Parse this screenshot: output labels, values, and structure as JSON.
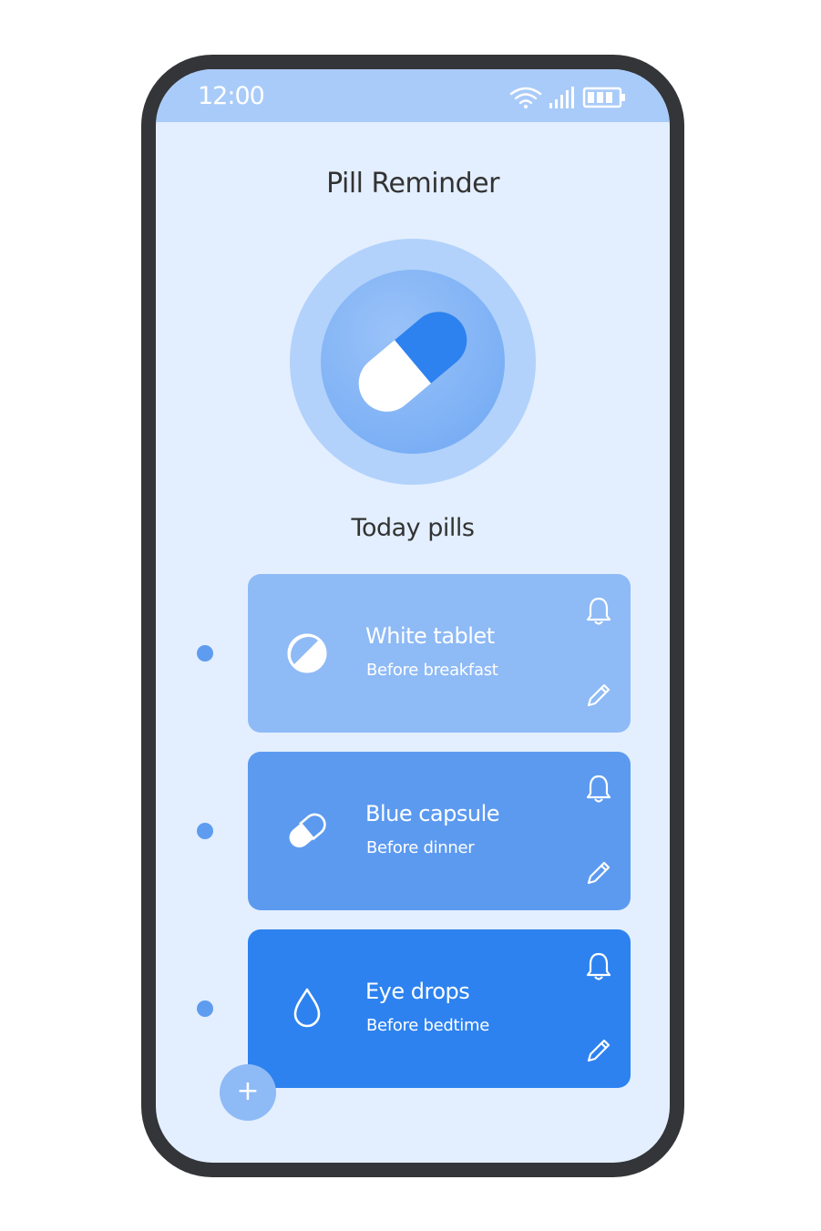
{
  "status_bar": {
    "time": "12:00",
    "icons": [
      "wifi-icon",
      "signal-icon",
      "battery-icon"
    ]
  },
  "header": {
    "title": "Pill Reminder"
  },
  "hero": {
    "icon": "capsule-icon"
  },
  "section": {
    "title": "Today pills"
  },
  "pills": [
    {
      "name": "White tablet",
      "timing": "Before breakfast",
      "icon": "tablet-icon",
      "color": "#8ebaf6"
    },
    {
      "name": "Blue capsule",
      "timing": "Before dinner",
      "icon": "capsule-icon",
      "color": "#5c9af0"
    },
    {
      "name": "Eye drops",
      "timing": "Before bedtime",
      "icon": "drop-icon",
      "color": "#2d82ef"
    }
  ],
  "actions": {
    "add_label": "+"
  },
  "colors": {
    "screen_background": "#e3efff",
    "status_bar": "#a9cbf9",
    "accent": "#2d82ef",
    "timeline_dot": "#5e9cf0"
  }
}
